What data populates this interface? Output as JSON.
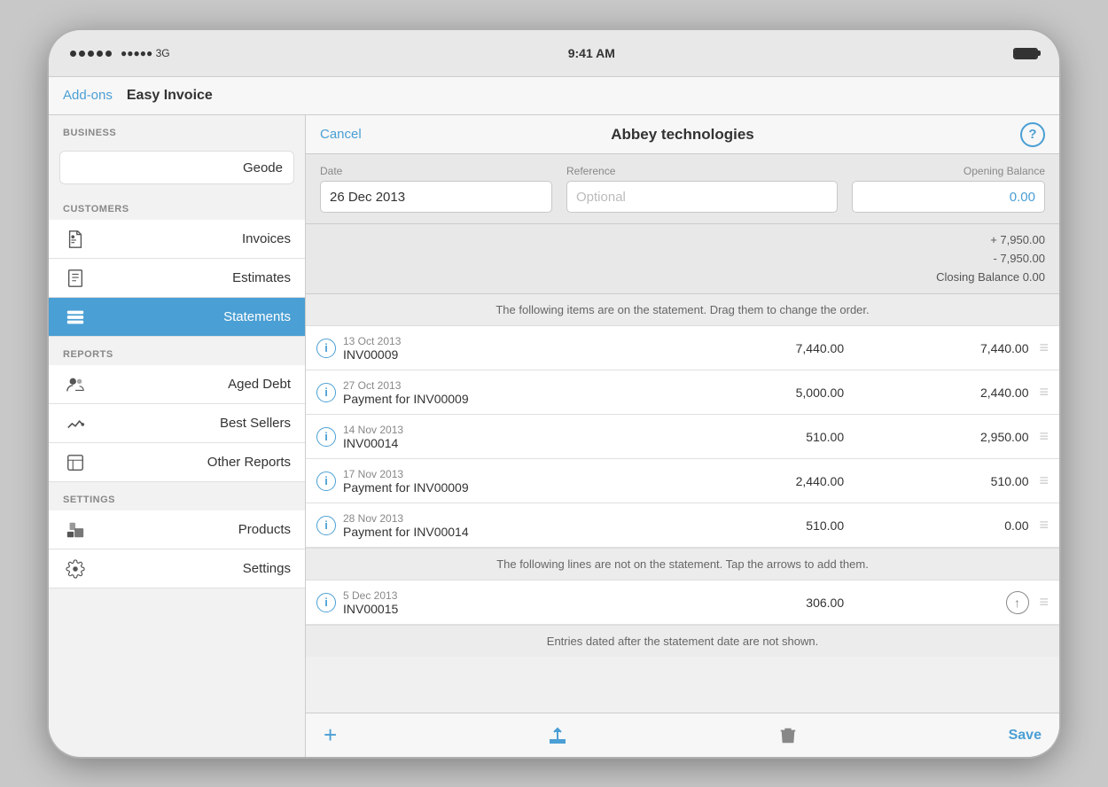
{
  "status_bar": {
    "signal": "●●●●● 3G",
    "time": "9:41 AM",
    "battery_label": "Battery"
  },
  "nav": {
    "addons_label": "Add-ons",
    "app_title": "Easy Invoice"
  },
  "sidebar": {
    "business_section": "BUSINESS",
    "business_value": "Geode",
    "customers_section": "CUSTOMERS",
    "reports_section": "REPORTS",
    "settings_section": "SETTINGS",
    "items": [
      {
        "id": "invoices",
        "label": "Invoices",
        "active": false
      },
      {
        "id": "estimates",
        "label": "Estimates",
        "active": false
      },
      {
        "id": "statements",
        "label": "Statements",
        "active": true
      }
    ],
    "report_items": [
      {
        "id": "aged-debt",
        "label": "Aged Debt",
        "active": false
      },
      {
        "id": "best-sellers",
        "label": "Best Sellers",
        "active": false
      },
      {
        "id": "other-reports",
        "label": "Other Reports",
        "active": false
      }
    ],
    "settings_items": [
      {
        "id": "products",
        "label": "Products",
        "active": false
      },
      {
        "id": "settings",
        "label": "Settings",
        "active": false
      }
    ]
  },
  "main": {
    "cancel_label": "Cancel",
    "title": "Abbey technologies",
    "help_label": "?",
    "form": {
      "date_label": "Date",
      "date_value": "26 Dec 2013",
      "reference_label": "Reference",
      "reference_placeholder": "Optional",
      "opening_balance_label": "Opening Balance",
      "opening_balance_value": "0.00"
    },
    "summary": {
      "line1": "+ 7,950.00",
      "line2": "- 7,950.00",
      "closing": "Closing Balance 0.00"
    },
    "drag_hint": "The following items are on the statement. Drag them to change the order.",
    "statement_items": [
      {
        "date": "13 Oct 2013",
        "name": "INV00009",
        "amount": "7,440.00",
        "balance": "7,440.00"
      },
      {
        "date": "27 Oct 2013",
        "name": "Payment for INV00009",
        "amount": "5,000.00",
        "balance": "2,440.00"
      },
      {
        "date": "14 Nov 2013",
        "name": "INV00014",
        "amount": "510.00",
        "balance": "2,950.00"
      },
      {
        "date": "17 Nov 2013",
        "name": "Payment for INV00009",
        "amount": "2,440.00",
        "balance": "510.00"
      },
      {
        "date": "28 Nov 2013",
        "name": "Payment for INV00014",
        "amount": "510.00",
        "balance": "0.00"
      }
    ],
    "not_on_stmt_hint": "The following lines are not on the statement. Tap the arrows to add them.",
    "not_on_stmt_items": [
      {
        "date": "5 Dec 2013",
        "name": "INV00015",
        "amount": "306.00"
      }
    ],
    "after_date_hint": "Entries dated after the statement date are not shown.",
    "toolbar": {
      "add_label": "+",
      "share_label": "share",
      "trash_label": "trash",
      "save_label": "Save"
    }
  }
}
